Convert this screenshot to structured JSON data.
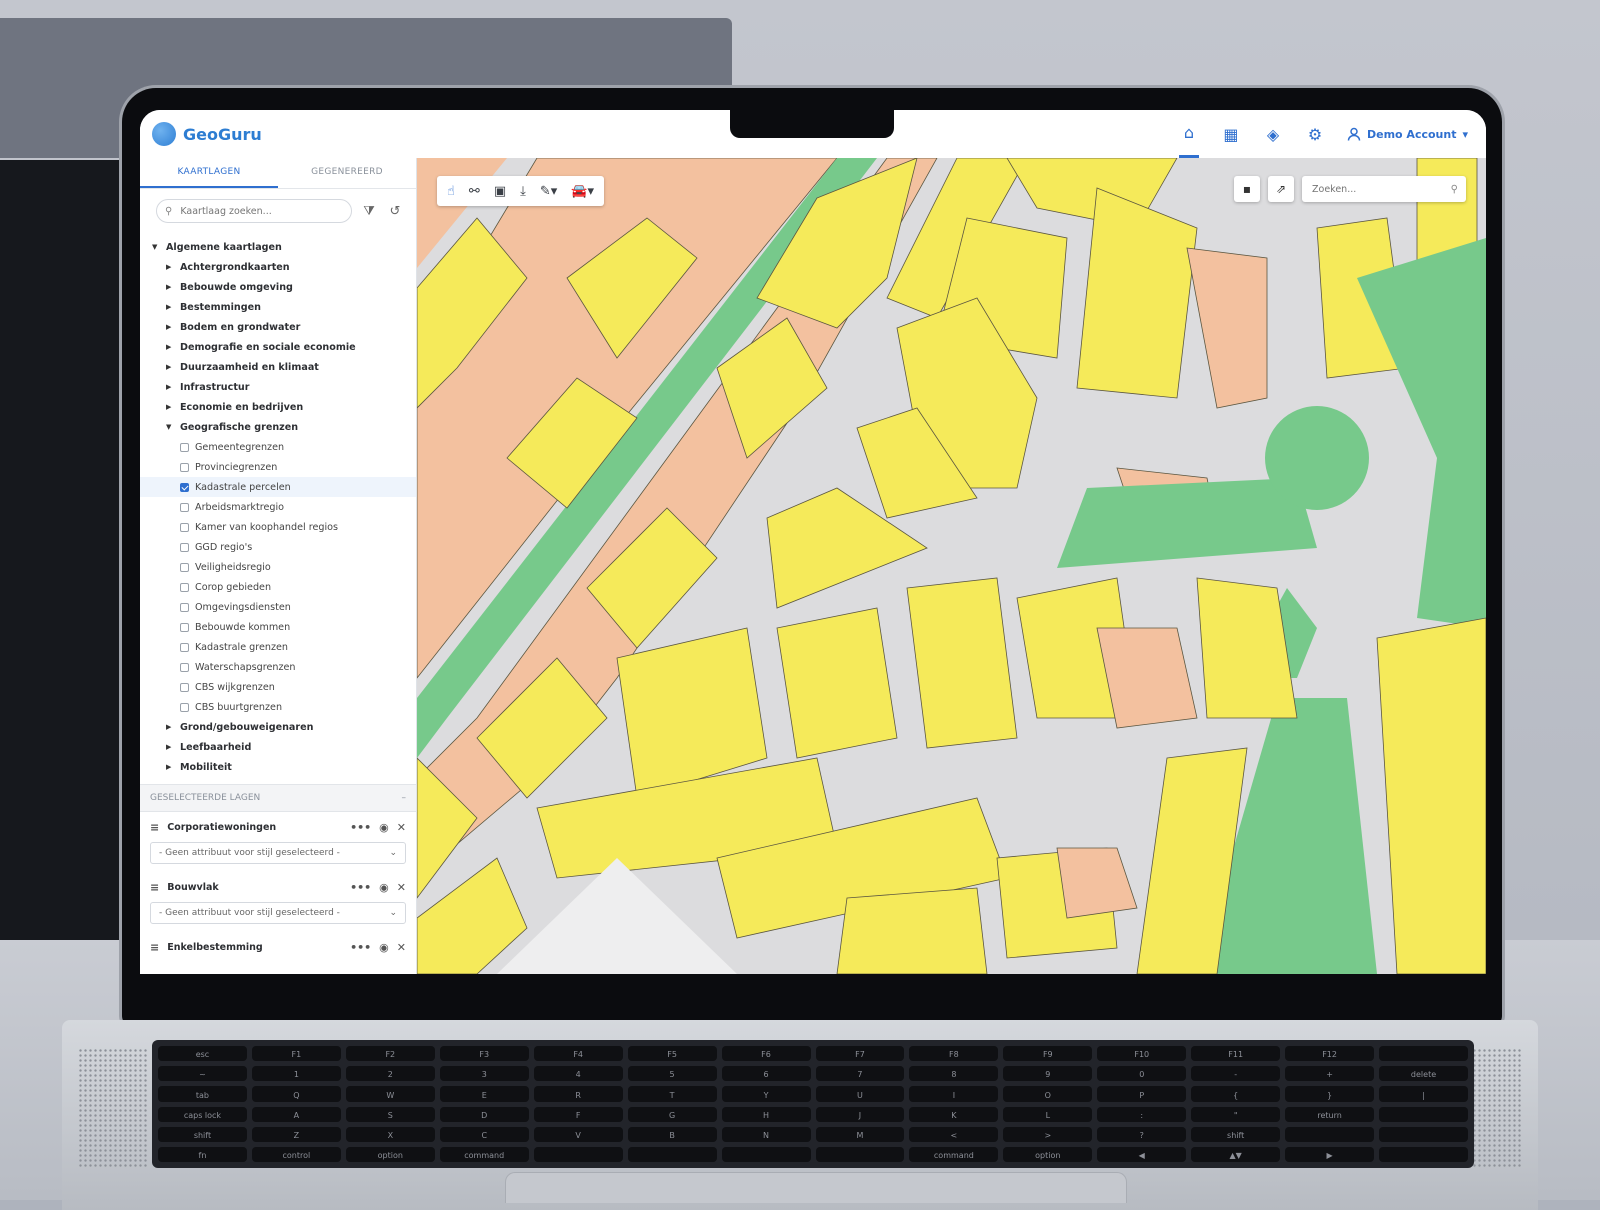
{
  "app": {
    "name": "GeoGuru"
  },
  "header": {
    "nav": [
      {
        "icon": "home-icon",
        "glyph": "⌂"
      },
      {
        "icon": "calculator-icon",
        "glyph": "▦"
      },
      {
        "icon": "layers-icon",
        "glyph": "◈"
      },
      {
        "icon": "gear-icon",
        "glyph": "⚙"
      }
    ],
    "account_label": "Demo Account"
  },
  "sidebar": {
    "tabs": [
      "KAARTLAGEN",
      "GEGENEREERD"
    ],
    "search_placeholder": "Kaartlaag zoeken...",
    "tree": {
      "root": "Algemene kaartlagen",
      "groups_before": [
        "Achtergrondkaarten",
        "Bebouwde omgeving",
        "Bestemmingen",
        "Bodem en grondwater",
        "Demografie en sociale economie",
        "Duurzaamheid en klimaat",
        "Infrastructur",
        "Economie en bedrijven"
      ],
      "expanded_group": "Geografische grenzen",
      "layers": [
        {
          "label": "Gemeentegrenzen",
          "checked": false
        },
        {
          "label": "Provinciegrenzen",
          "checked": false
        },
        {
          "label": "Kadastrale percelen",
          "checked": true
        },
        {
          "label": "Arbeidsmarktregio",
          "checked": false
        },
        {
          "label": "Kamer van koophandel regios",
          "checked": false
        },
        {
          "label": "GGD regio's",
          "checked": false
        },
        {
          "label": "Veiligheidsregio",
          "checked": false
        },
        {
          "label": "Corop gebieden",
          "checked": false
        },
        {
          "label": "Omgevingsdiensten",
          "checked": false
        },
        {
          "label": "Bebouwde kommen",
          "checked": false
        },
        {
          "label": "Kadastrale grenzen",
          "checked": false
        },
        {
          "label": "Waterschapsgrenzen",
          "checked": false
        },
        {
          "label": "CBS wijkgrenzen",
          "checked": false
        },
        {
          "label": "CBS buurtgrenzen",
          "checked": false
        }
      ],
      "groups_after": [
        "Grond/gebouweigenaren",
        "Leefbaarheid",
        "Mobiliteit"
      ]
    },
    "selected_section": {
      "title": "GESELECTEERDE LAGEN",
      "collapse_glyph": "–",
      "layers": [
        {
          "name": "Corporatiewoningen",
          "select_value": "- Geen attribuut voor stijl geselecteerd -"
        },
        {
          "name": "Bouwvlak",
          "select_value": "- Geen attribuut voor stijl geselecteerd -"
        },
        {
          "name": "Enkelbestemming"
        }
      ]
    }
  },
  "map": {
    "search_placeholder": "Zoeken...",
    "toolbar": [
      "pointer-icon",
      "route-icon",
      "select-area-icon",
      "download-icon",
      "ruler-icon",
      "car-icon"
    ],
    "colors": {
      "residential": "#f5ea5a",
      "commercial": "#f3c19f",
      "green": "#77c98b",
      "road": "#dcdcde",
      "outline": "#5b5640"
    }
  },
  "colors": {
    "accent": "#2f6fcf"
  },
  "keyboard": {
    "rows": [
      [
        "esc",
        "F1",
        "F2",
        "F3",
        "F4",
        "F5",
        "F6",
        "F7",
        "F8",
        "F9",
        "F10",
        "F11",
        "F12",
        ""
      ],
      [
        "~",
        "1",
        "2",
        "3",
        "4",
        "5",
        "6",
        "7",
        "8",
        "9",
        "0",
        "-",
        "+",
        "delete"
      ],
      [
        "tab",
        "Q",
        "W",
        "E",
        "R",
        "T",
        "Y",
        "U",
        "I",
        "O",
        "P",
        "{",
        "}",
        "|"
      ],
      [
        "caps lock",
        "A",
        "S",
        "D",
        "F",
        "G",
        "H",
        "J",
        "K",
        "L",
        ":",
        "\"",
        "return",
        ""
      ],
      [
        "shift",
        "Z",
        "X",
        "C",
        "V",
        "B",
        "N",
        "M",
        "<",
        ">",
        "?",
        "shift",
        "",
        ""
      ],
      [
        "fn",
        "control",
        "option",
        "command",
        "",
        "",
        "",
        "",
        "command",
        "option",
        "◀",
        "▲▼",
        "▶",
        ""
      ]
    ]
  }
}
